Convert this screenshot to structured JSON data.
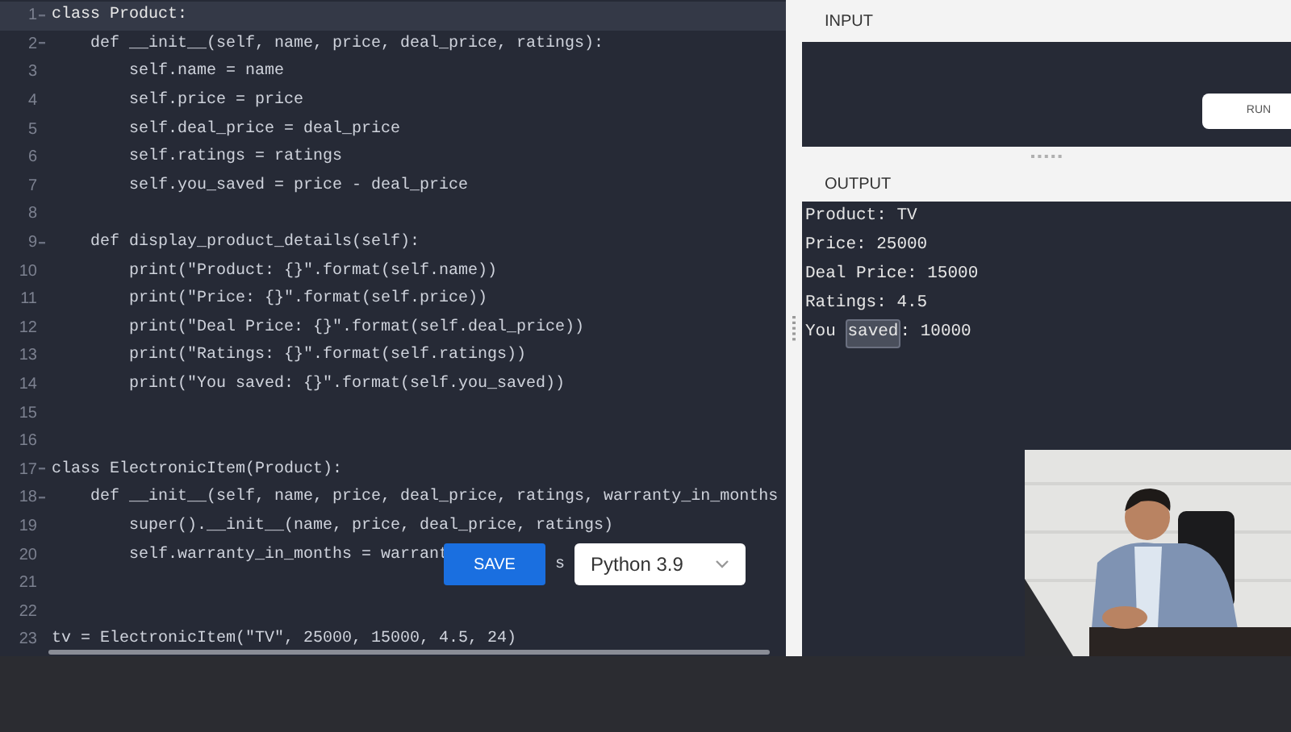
{
  "editor": {
    "lines": [
      {
        "number": "1",
        "text": "class Product:",
        "foldable": true,
        "selected": true
      },
      {
        "number": "2",
        "text": "    def __init__(self, name, price, deal_price, ratings):",
        "foldable": true,
        "selected": false
      },
      {
        "number": "3",
        "text": "        self.name = name",
        "foldable": false,
        "selected": false
      },
      {
        "number": "4",
        "text": "        self.price = price",
        "foldable": false,
        "selected": false
      },
      {
        "number": "5",
        "text": "        self.deal_price = deal_price",
        "foldable": false,
        "selected": false
      },
      {
        "number": "6",
        "text": "        self.ratings = ratings",
        "foldable": false,
        "selected": false
      },
      {
        "number": "7",
        "text": "        self.you_saved = price - deal_price",
        "foldable": false,
        "selected": false
      },
      {
        "number": "8",
        "foldable": false,
        "selected": false
      },
      {
        "number": "9",
        "text": "    def display_product_details(self):",
        "foldable": true,
        "selected": false
      },
      {
        "number": "10",
        "text": "        print(\"Product: {}\".format(self.name))",
        "foldable": false,
        "selected": false
      },
      {
        "number": "11",
        "text": "        print(\"Price: {}\".format(self.price))",
        "foldable": false,
        "selected": false
      },
      {
        "number": "12",
        "text": "        print(\"Deal Price: {}\".format(self.deal_price))",
        "foldable": false,
        "selected": false
      },
      {
        "number": "13",
        "text": "        print(\"Ratings: {}\".format(self.ratings))",
        "foldable": false,
        "selected": false
      },
      {
        "number": "14",
        "text": "        print(\"You saved: {}\".format(self.you_saved))",
        "foldable": false,
        "selected": false
      },
      {
        "number": "15",
        "foldable": false,
        "selected": false
      },
      {
        "number": "16",
        "foldable": false,
        "selected": false
      },
      {
        "number": "17",
        "text": "class ElectronicItem(Product):",
        "foldable": true,
        "selected": false
      },
      {
        "number": "18",
        "text": "    def __init__(self, name, price, deal_price, ratings, warranty_in_months",
        "foldable": true,
        "selected": false
      },
      {
        "number": "19",
        "text": "        super().__init__(name, price, deal_price, ratings)",
        "foldable": false,
        "selected": false
      },
      {
        "number": "20",
        "text": "        self.warranty_in_months = warrant",
        "foldable": false,
        "selected": false
      },
      {
        "number": "21",
        "foldable": false,
        "selected": false
      },
      {
        "number": "22",
        "foldable": false,
        "selected": false
      },
      {
        "number": "23",
        "text": "tv = ElectronicItem(\"TV\", 25000, 15000, 4.5, 24)",
        "foldable": false,
        "selected": false
      }
    ]
  },
  "save_button": "SAVE",
  "code_fragment": "s",
  "language_select": {
    "value": "Python 3.9"
  },
  "input": {
    "label": "INPUT",
    "run_button": "RUN"
  },
  "output": {
    "label": "OUTPUT",
    "lines": [
      {
        "parts": [
          {
            "text": "Product: TV",
            "selected": false
          }
        ]
      },
      {
        "parts": [
          {
            "text": "Price: 25000",
            "selected": false
          }
        ]
      },
      {
        "parts": [
          {
            "text": "Deal Price: 15000",
            "selected": false
          }
        ]
      },
      {
        "parts": [
          {
            "text": "Ratings: 4.5",
            "selected": false
          }
        ]
      },
      {
        "parts": [
          {
            "text": "You ",
            "selected": false
          },
          {
            "text": "saved",
            "selected": true
          },
          {
            "text": ": 10000",
            "selected": false
          }
        ]
      }
    ]
  }
}
